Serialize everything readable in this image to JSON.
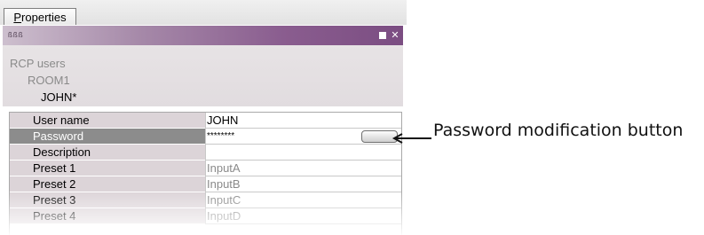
{
  "tab": {
    "label_first": "P",
    "label_rest": "roperties"
  },
  "titlebar": {
    "grip": "ßßß"
  },
  "tree": {
    "root": "RCP users",
    "room": "ROOM1",
    "user": "JOHN*"
  },
  "grid": {
    "rows": [
      {
        "name": "User name",
        "value": "JOHN"
      },
      {
        "name": "Password",
        "value": "********"
      },
      {
        "name": "Description",
        "value": ""
      },
      {
        "name": "Preset 1",
        "value": "InputA"
      },
      {
        "name": "Preset 2",
        "value": "InputB"
      },
      {
        "name": "Preset 3",
        "value": "InputC"
      },
      {
        "name": "Preset 4",
        "value": "InputD"
      }
    ]
  },
  "callout": {
    "label": "Password modification button"
  },
  "colors": {
    "titlebar_end": "#7b4d82",
    "selected_row": "#8c8c8c"
  }
}
